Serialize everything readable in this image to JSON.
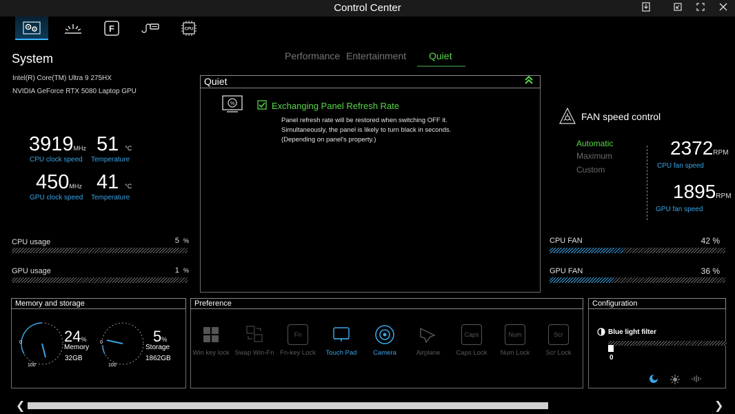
{
  "window": {
    "title": "Control Center",
    "minimize": "⧉",
    "restore": "◱",
    "close": "✕"
  },
  "nav": [
    {
      "name": "system-settings",
      "icon": "gear-grid-icon"
    },
    {
      "name": "lighting",
      "icon": "light-icon"
    },
    {
      "name": "function-key",
      "icon": "f-key-icon",
      "label": "F"
    },
    {
      "name": "usb-devices",
      "icon": "usb-icon"
    },
    {
      "name": "cpu",
      "icon": "cpu-icon",
      "label": "CPU"
    }
  ],
  "system": {
    "title": "System",
    "cpu_name": "Intel(R) Core(TM) Ultra 9 275HX",
    "gpu_name": "NVIDIA GeForce RTX 5080 Laptop GPU",
    "cpu_clock": "3919",
    "cpu_clock_unit": "MHz",
    "cpu_clock_label": "CPU clock speed",
    "cpu_temp": "51",
    "cpu_temp_unit": "°C",
    "cpu_temp_label": "Temperature",
    "gpu_clock": "450",
    "gpu_clock_unit": "MHz",
    "gpu_clock_label": "GPU clock speed",
    "gpu_temp": "41",
    "gpu_temp_unit": "°C",
    "gpu_temp_label": "Temperature",
    "cpu_usage_label": "CPU usage",
    "cpu_usage": "5",
    "cpu_usage_unit": "%",
    "gpu_usage_label": "GPU usage",
    "gpu_usage": "1",
    "gpu_usage_unit": "%"
  },
  "modes": {
    "performance": "Performance",
    "entertainment": "Entertainment",
    "quiet": "Quiet"
  },
  "quiet": {
    "title": "Quiet",
    "feature": "Exchanging Panel Refresh Rate",
    "desc1": "Panel refresh rate will be restored when switching OFF it.",
    "desc2": "Simultaneously, the panel is likely to turn black in seconds.",
    "desc3": "(Depending on panel's property.)",
    "checked": true
  },
  "fan": {
    "title": "FAN speed control",
    "automatic": "Automatic",
    "maximum": "Maximum",
    "custom": "Custom",
    "cpu_rpm": "2372",
    "cpu_rpm_unit": "RPM",
    "cpu_rpm_label": "CPU fan speed",
    "gpu_rpm": "1895",
    "gpu_rpm_unit": "RPM",
    "gpu_rpm_label": "GPU fan speed",
    "cpu_fan_label": "CPU FAN",
    "cpu_fan_pct": "42 %",
    "cpu_fan_level": 0.42,
    "gpu_fan_label": "GPU FAN",
    "gpu_fan_pct": "36 %",
    "gpu_fan_level": 0.36
  },
  "memory": {
    "title": "Memory and storage",
    "mem_pct": "24",
    "mem_pct_unit": "%",
    "mem_label": "Memory",
    "mem_size": "32GB",
    "sto_pct": "5",
    "sto_pct_unit": "%",
    "sto_label": "Storage",
    "sto_size": "1862GB",
    "gauge_min": "0",
    "gauge_max": "100"
  },
  "preference": {
    "title": "Preference",
    "items": [
      {
        "label": "Win key lock",
        "on": false
      },
      {
        "label": "Swap Win-Fn",
        "on": false
      },
      {
        "label": "Fn-key Lock",
        "on": false,
        "glyph": "Fn"
      },
      {
        "label": "Touch Pad",
        "on": true
      },
      {
        "label": "Camera",
        "on": true
      },
      {
        "label": "Airplane",
        "on": false
      },
      {
        "label": "Caps Lock",
        "on": false,
        "glyph": "Caps"
      },
      {
        "label": "Num Lock",
        "on": false,
        "glyph": "Num"
      },
      {
        "label": "Scr Lock",
        "on": false,
        "glyph": "Scr"
      }
    ]
  },
  "config": {
    "title": "Configuration",
    "blue_light": "Blue light filter",
    "blue_light_value": "0"
  },
  "colors": {
    "accent_blue": "#3aa5e6",
    "accent_green": "#58d84a"
  }
}
